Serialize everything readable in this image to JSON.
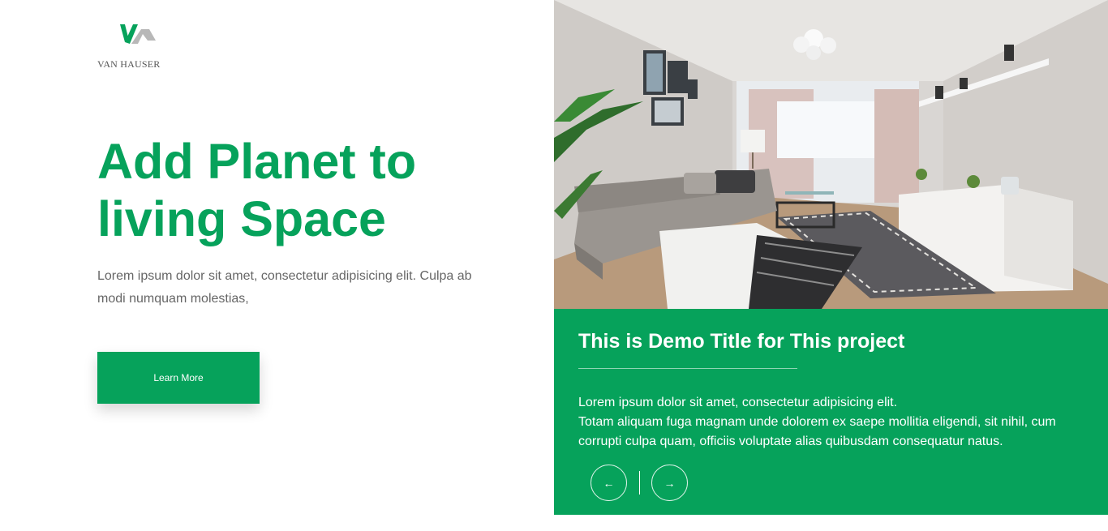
{
  "brand": {
    "name": "VAN HAUSER",
    "logo_icon": "vh-roof-logo-icon",
    "accent_color": "#06a25b"
  },
  "hero": {
    "title_line1": "Add Planet to",
    "title_line2": "living Space",
    "description": "Lorem ipsum dolor sit amet, consectetur adipisicing elit. Culpa ab modi numquam molestias,",
    "button_label": "Learn More"
  },
  "project": {
    "image_icon": "living-room-photo",
    "title": "This is Demo Title for This project",
    "body_line1": "Lorem ipsum dolor sit amet, consectetur adipisicing elit.",
    "body_line2": "Totam aliquam fuga magnam unde dolorem ex saepe mollitia eligendi, sit nihil, cum corrupti culpa quam, officiis voluptate alias quibusdam consequatur natus.",
    "prev_icon": "arrow-left-icon",
    "next_icon": "arrow-right-icon"
  }
}
